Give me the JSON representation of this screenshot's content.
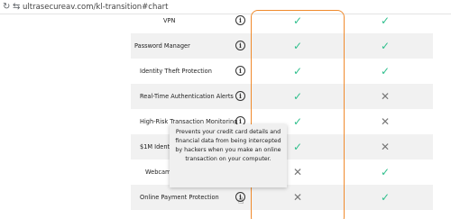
{
  "browser": {
    "url": "ultrasecureav.com/kl-transition#chart",
    "reload_icon": "reload-icon",
    "site_info_icon": "site-settings-icon"
  },
  "features": [
    {
      "label": "VPN",
      "col1": "check",
      "col2": "check"
    },
    {
      "label": "Password Manager",
      "col1": "check",
      "col2": "check"
    },
    {
      "label": "Identity Theft Protection",
      "col1": "check",
      "col2": "check"
    },
    {
      "label": "Real-Time Authentication Alerts",
      "col1": "check",
      "col2": "cross"
    },
    {
      "label": "High-Risk Transaction Monitoring",
      "col1": "check",
      "col2": "cross"
    },
    {
      "label": "$1M Identity Theft Ins",
      "col1": "check",
      "col2": "cross"
    },
    {
      "label": "Webcam Protection",
      "col1": "cross",
      "col2": "check"
    },
    {
      "label": "Online Payment Protection",
      "col1": "cross",
      "col2": "check"
    }
  ],
  "tooltip": {
    "text": "Prevents your credit card details and financial data from being intercepted by hackers when you make an online transaction on your computer."
  },
  "colors": {
    "check": "#2fbf8c",
    "highlight_border": "#f08a2c"
  }
}
